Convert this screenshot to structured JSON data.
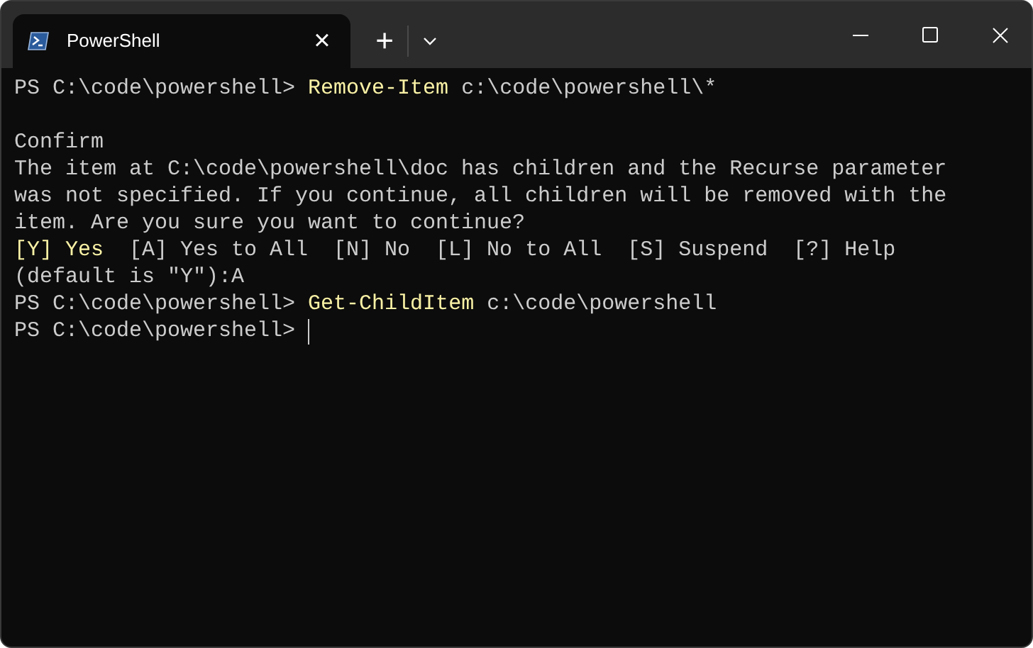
{
  "tab": {
    "title": "PowerShell",
    "selected": true,
    "close": "×"
  },
  "new_tab": "+",
  "lines": [
    {
      "segments": [
        {
          "text": "PS C:\\code\\powershell> ",
          "kind": "plain"
        },
        {
          "text": "Remove-Item",
          "kind": "command"
        },
        {
          "text": " c:\\code\\powershell\\*",
          "kind": "plain"
        }
      ]
    },
    {
      "kind": "blank"
    },
    {
      "segments": [
        {
          "text": "Confirm",
          "kind": "plain"
        }
      ]
    },
    {
      "segments": [
        {
          "text": "The item at C:\\code\\powershell\\doc has children and the Recurse parameter",
          "kind": "plain"
        }
      ]
    },
    {
      "segments": [
        {
          "text": "was not specified. If you continue, all children will be removed with the",
          "kind": "plain"
        }
      ]
    },
    {
      "segments": [
        {
          "text": "item. Are you sure you want to continue?",
          "kind": "plain"
        }
      ]
    },
    {
      "segments": [
        {
          "text": "[Y] Yes",
          "kind": "command"
        },
        {
          "text": "  [A] Yes to All  [N] No  [L] No to All  [S] Suspend  [?] Help",
          "kind": "plain"
        }
      ]
    },
    {
      "segments": [
        {
          "text": "(default is \"Y\"):A",
          "kind": "plain"
        }
      ]
    },
    {
      "segments": [
        {
          "text": "PS C:\\code\\powershell> ",
          "kind": "plain"
        },
        {
          "text": "Get-ChildItem",
          "kind": "command"
        },
        {
          "text": " c:\\code\\powershell",
          "kind": "plain"
        }
      ]
    },
    {
      "segments": [
        {
          "text": "PS C:\\code\\powershell> ",
          "kind": "plain"
        }
      ],
      "cursor": true
    }
  ]
}
